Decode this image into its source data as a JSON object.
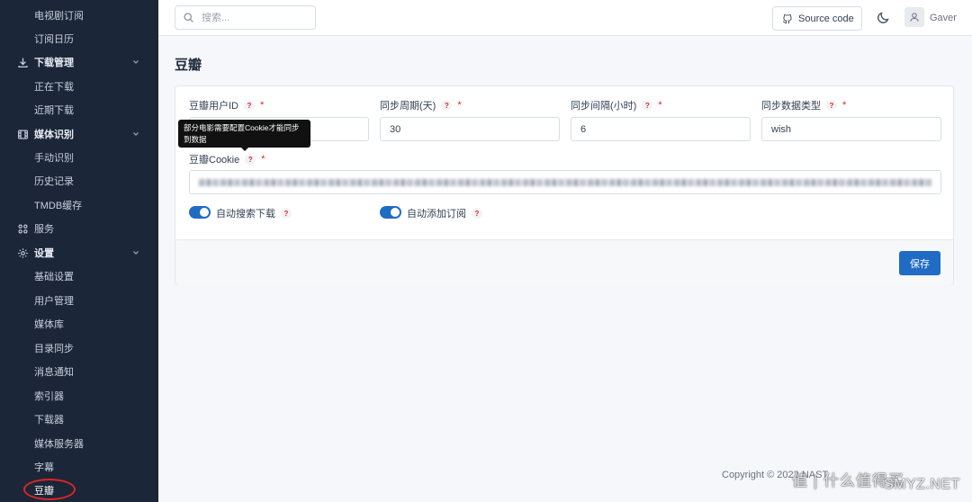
{
  "sidebar": {
    "items": [
      {
        "label": "电视剧订阅",
        "kind": "sub"
      },
      {
        "label": "订阅日历",
        "kind": "sub"
      },
      {
        "label": "下载管理",
        "kind": "group",
        "icon": "download-icon",
        "expanded": true
      },
      {
        "label": "正在下载",
        "kind": "sub"
      },
      {
        "label": "近期下载",
        "kind": "sub"
      },
      {
        "label": "媒体识别",
        "kind": "group",
        "icon": "film-icon",
        "expanded": true
      },
      {
        "label": "手动识别",
        "kind": "sub"
      },
      {
        "label": "历史记录",
        "kind": "sub"
      },
      {
        "label": "TMDB缓存",
        "kind": "sub"
      },
      {
        "label": "服务",
        "kind": "group-plain",
        "icon": "apps-icon"
      },
      {
        "label": "设置",
        "kind": "group",
        "icon": "gear-icon",
        "expanded": true
      },
      {
        "label": "基础设置",
        "kind": "sub"
      },
      {
        "label": "用户管理",
        "kind": "sub"
      },
      {
        "label": "媒体库",
        "kind": "sub"
      },
      {
        "label": "目录同步",
        "kind": "sub"
      },
      {
        "label": "消息通知",
        "kind": "sub"
      },
      {
        "label": "索引器",
        "kind": "sub"
      },
      {
        "label": "下载器",
        "kind": "sub"
      },
      {
        "label": "媒体服务器",
        "kind": "sub"
      },
      {
        "label": "字幕",
        "kind": "sub"
      },
      {
        "label": "豆瓣",
        "kind": "sub",
        "active": true
      }
    ]
  },
  "topbar": {
    "search_placeholder": "搜索...",
    "source_code_label": "Source code",
    "username": "Gaver"
  },
  "page": {
    "title": "豆瓣"
  },
  "form": {
    "user_id_label": "豆瓣用户ID",
    "user_id_value": "",
    "sync_period_label": "同步周期(天)",
    "sync_period_value": "30",
    "sync_interval_label": "同步间隔(小时)",
    "sync_interval_value": "6",
    "sync_type_label": "同步数据类型",
    "sync_type_value": "wish",
    "cookie_label": "豆瓣Cookie",
    "auto_search_label": "自动搜索下载",
    "auto_search_on": true,
    "auto_subscribe_label": "自动添加订阅",
    "auto_subscribe_on": true,
    "help_mark": "?",
    "required_mark": "*",
    "tooltip_text": "部分电影需要配置Cookie才能同步到数据",
    "save_label": "保存"
  },
  "footer": {
    "copyright": "Copyright © 2022 NAST"
  },
  "watermark": {
    "text1": "值 | 什么值得买",
    "text2": "SMYZ.NET"
  },
  "colors": {
    "sidebar_bg": "#1b2638",
    "accent": "#206bc4",
    "active_ring": "#e02424"
  }
}
